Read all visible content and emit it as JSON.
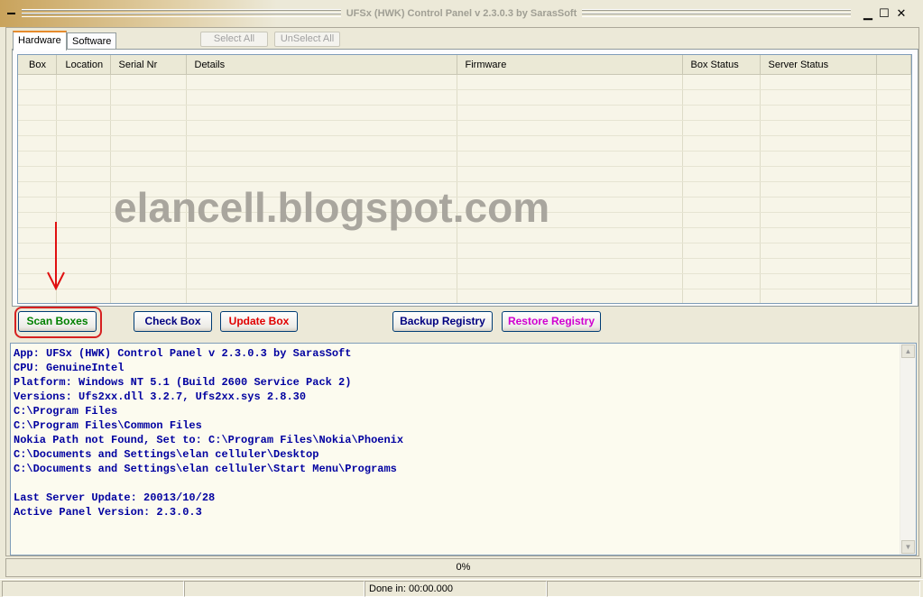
{
  "window": {
    "title": "UFSx (HWK) Control Panel v 2.3.0.3 by SarasSoft",
    "minimize_glyph": "▁",
    "maximize_glyph": "☐",
    "close_glyph": "✕"
  },
  "tabs": [
    {
      "label": "Hardware",
      "active": true
    },
    {
      "label": "Software",
      "active": false
    }
  ],
  "selection": {
    "select_all_label": "Select All",
    "unselect_all_label": "UnSelect All"
  },
  "grid": {
    "columns": [
      "Box",
      "Location",
      "Serial Nr",
      "Details",
      "Firmware",
      "Box Status",
      "Server Status",
      ""
    ],
    "rows": []
  },
  "watermark": "elancell.blogspot.com",
  "buttons": {
    "scan_boxes": {
      "label": "Scan Boxes",
      "color": "#008000"
    },
    "check_box": {
      "label": "Check Box",
      "color": "#000080"
    },
    "update_box": {
      "label": "Update Box",
      "color": "#e00000"
    },
    "backup_registry": {
      "label": "Backup Registry",
      "color": "#000080"
    },
    "restore_registry": {
      "label": "Restore Registry",
      "color": "#d000d0"
    }
  },
  "annotation": {
    "arrow_color": "#e01010",
    "ring_color": "#d62020"
  },
  "log": {
    "text_color": "#0000a0",
    "lines": [
      "App: UFSx (HWK) Control Panel v 2.3.0.3 by SarasSoft",
      "CPU: GenuineIntel",
      "Platform: Windows NT 5.1 (Build 2600 Service Pack 2)",
      "Versions: Ufs2xx.dll 3.2.7, Ufs2xx.sys 2.8.30",
      "C:\\Program Files",
      "C:\\Program Files\\Common Files",
      "Nokia Path not Found, Set to: C:\\Program Files\\Nokia\\Phoenix",
      "C:\\Documents and Settings\\elan celluler\\Desktop",
      "C:\\Documents and Settings\\elan celluler\\Start Menu\\Programs",
      "",
      "Last Server Update: 20013/10/28",
      "Active Panel Version: 2.3.0.3"
    ]
  },
  "progress": {
    "label": "0%",
    "value": 0
  },
  "statusbar": {
    "cell1": "",
    "cell2": "",
    "done_in": "Done in: 00:00.000",
    "cell4": ""
  }
}
